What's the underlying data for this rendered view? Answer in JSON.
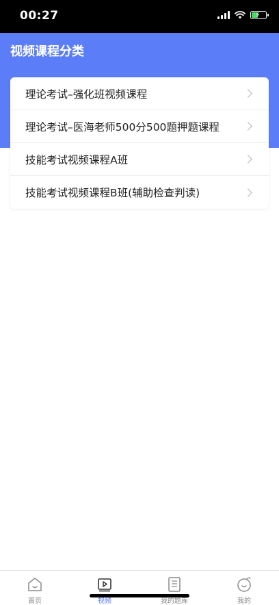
{
  "status_bar": {
    "time": "00:27"
  },
  "header": {
    "title": "视频课程分类",
    "background": "#5b7df7"
  },
  "courses": [
    {
      "label": "理论考试–强化班视频课程"
    },
    {
      "label": "理论考试–医海老师500分500题押题课程"
    },
    {
      "label": "技能考试视频课程A班"
    },
    {
      "label": "技能考试视频课程B班(辅助检查判读)"
    }
  ],
  "tab_bar": {
    "tabs": [
      {
        "label": "首页",
        "icon": "home-icon",
        "active": false
      },
      {
        "label": "视频",
        "icon": "video-icon",
        "active": true
      },
      {
        "label": "我的题库",
        "icon": "question-bank-icon",
        "active": false
      },
      {
        "label": "我的",
        "icon": "profile-icon",
        "active": false
      }
    ],
    "active_color": "#5b7df7",
    "inactive_color": "#8a8a8a"
  }
}
